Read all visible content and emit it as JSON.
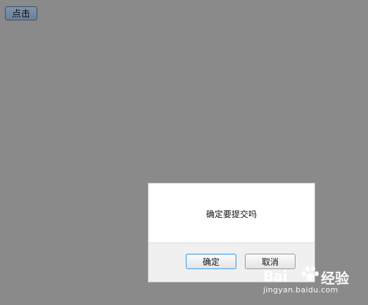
{
  "page": {
    "top_button_label": "点击"
  },
  "dialog": {
    "message": "确定要提交吗",
    "ok_label": "确定",
    "cancel_label": "取消"
  },
  "watermark": {
    "brand_left": "Bai",
    "brand_right": "经验",
    "url": "jingyan.baidu.com",
    "icon": "paw-print-icon"
  },
  "colors": {
    "background": "#8a8a8a",
    "dialog_background": "#ffffff",
    "footer_background": "#f0f0f0",
    "ok_border": "#4f9ee0",
    "top_button": "#7489a5"
  }
}
